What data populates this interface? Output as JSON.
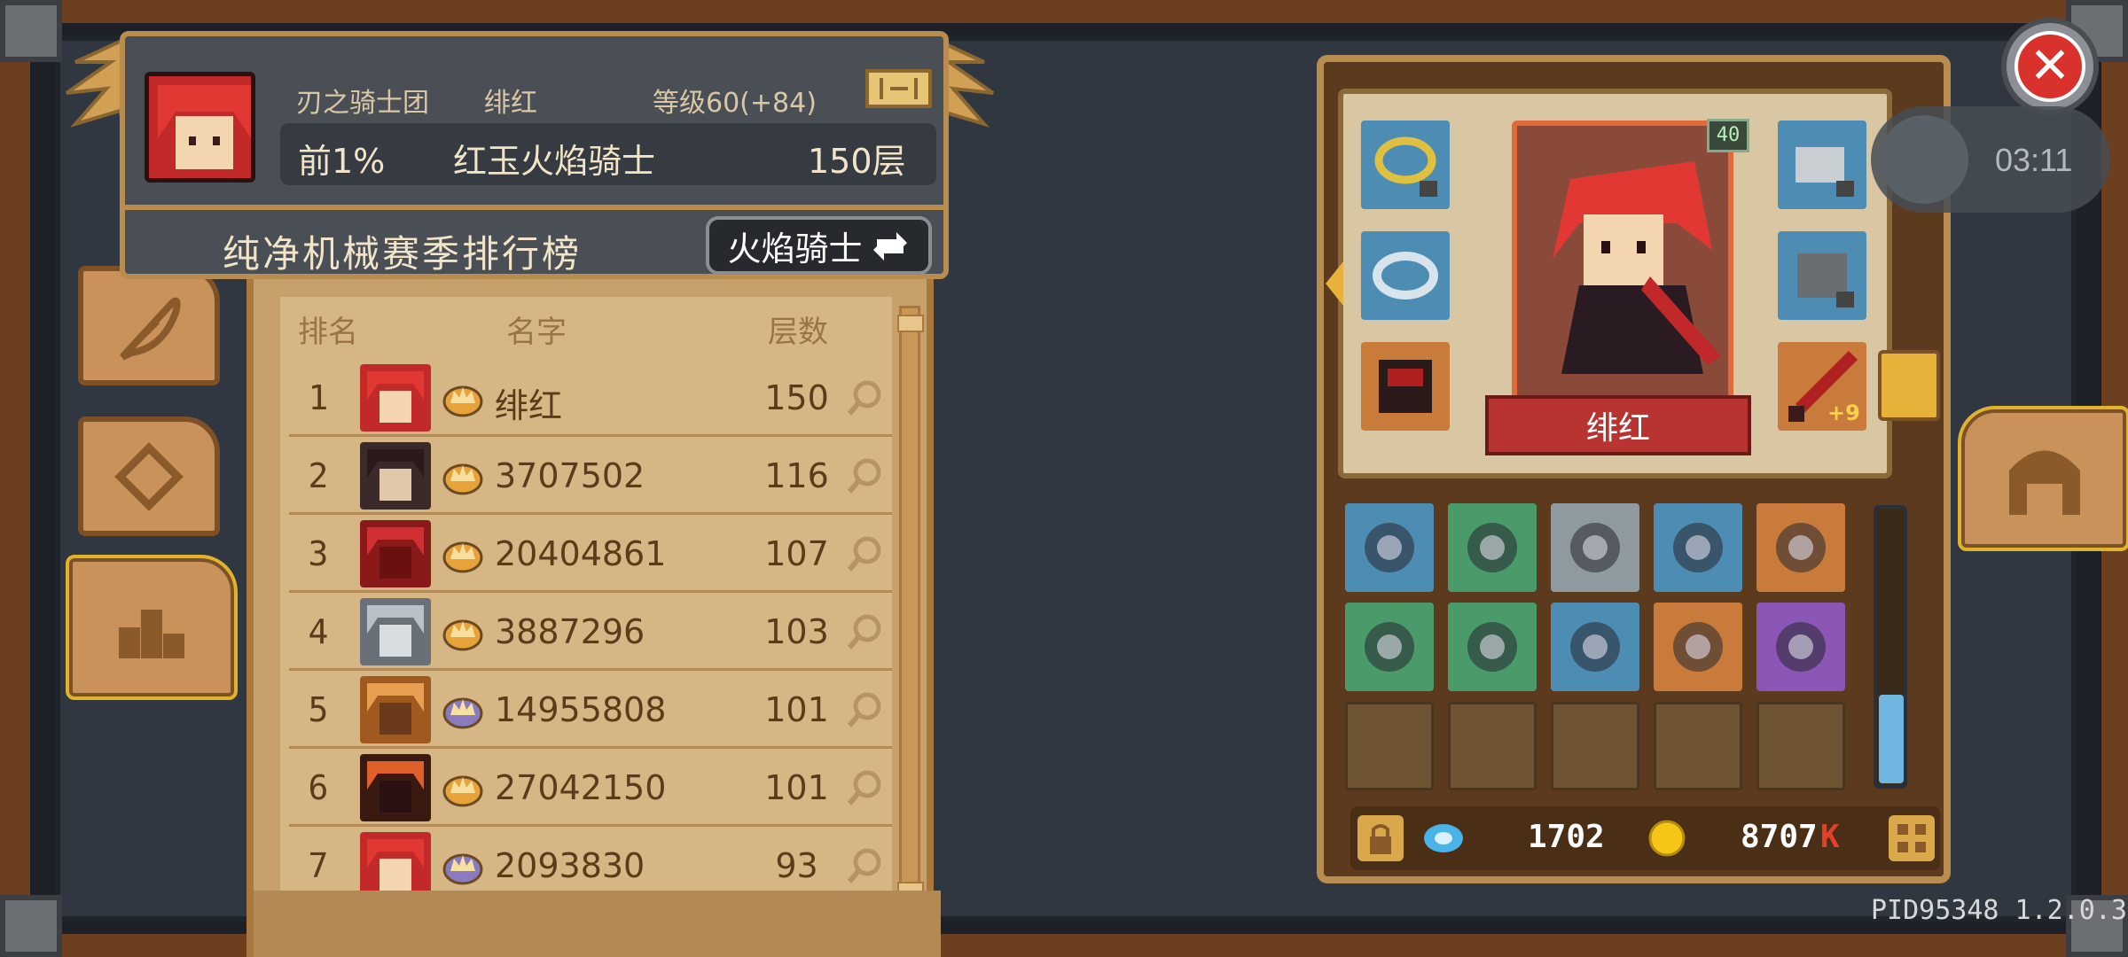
{
  "header": {
    "guild": "刃之骑士团",
    "player": "绯红",
    "level": "等级60(+84)",
    "percentile": "前1%",
    "title": "红玉火焰骑士",
    "floor": "150层",
    "season_title": "纯净机械赛季排行榜",
    "class_button": "火焰骑士"
  },
  "table": {
    "col_rank": "排名",
    "col_name": "名字",
    "col_floor": "层数",
    "rows": [
      {
        "rank": "1",
        "name": "绯红",
        "floors": "150",
        "face": "red",
        "crown": "gold"
      },
      {
        "rank": "2",
        "name": "3707502",
        "floors": "116",
        "face": "dark",
        "crown": "gold"
      },
      {
        "rank": "3",
        "name": "20404861",
        "floors": "107",
        "face": "crimson",
        "crown": "gold"
      },
      {
        "rank": "4",
        "name": "3887296",
        "floors": "103",
        "face": "silver",
        "crown": "gold"
      },
      {
        "rank": "5",
        "name": "14955808",
        "floors": "101",
        "face": "orange",
        "crown": "purple"
      },
      {
        "rank": "6",
        "name": "27042150",
        "floors": "101",
        "face": "lava",
        "crown": "gold"
      },
      {
        "rank": "7",
        "name": "2093830",
        "floors": "93",
        "face": "red",
        "crown": "purple"
      }
    ]
  },
  "equipment": {
    "hero_name": "绯红",
    "level_badge": "40",
    "weapon_plus": "+9",
    "gems": "1702",
    "gold": "8707",
    "gold_suffix": "K"
  },
  "timer": "03:11",
  "pid": "PID95348 1.2.0.3",
  "colors": {
    "wood": "#6b3f1f",
    "panel_tan": "#c8a06b",
    "accent_red": "#d9322d",
    "gold": "#e0b42a"
  },
  "icons": {
    "close": "close-icon",
    "swap": "swap-icon",
    "magnifier": "magnifier-icon",
    "crown": "crown-icon",
    "lock": "lock-icon",
    "gem": "gem-icon",
    "coin": "coin-icon"
  }
}
